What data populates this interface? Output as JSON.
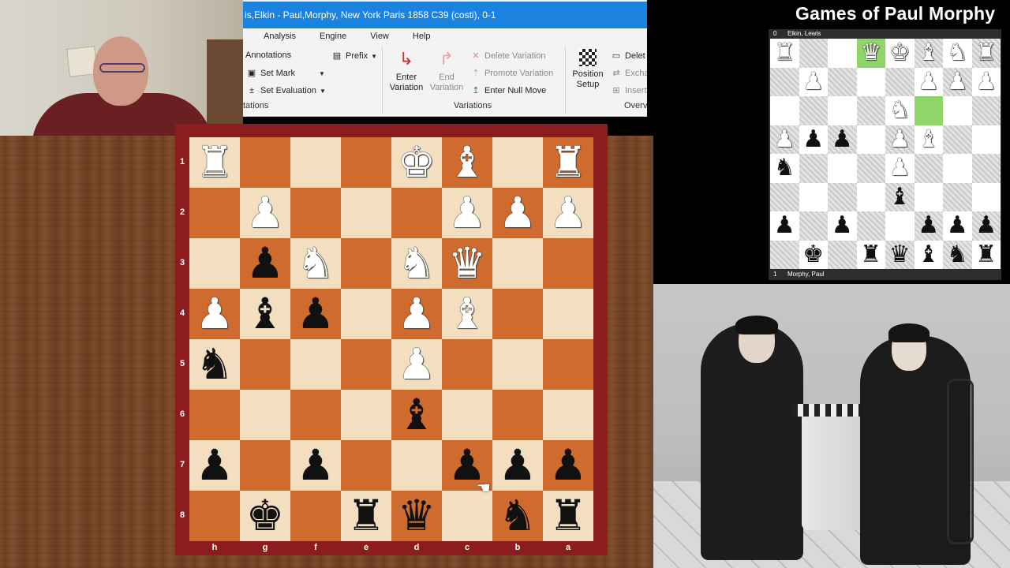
{
  "window": {
    "title": "is,Elkin - Paul,Morphy, New York Paris 1858  C39  (costi), 0-1"
  },
  "menu": [
    "Analysis",
    "Engine",
    "View",
    "Help"
  ],
  "ribbon": {
    "annotations": "Annotations",
    "prefix": "Prefix",
    "set_mark": "Set Mark",
    "set_evaluation": "Set Evaluation",
    "group_annotations": "tations",
    "enter_variation": [
      "Enter",
      "Variation"
    ],
    "end_variation": [
      "End",
      "Variation"
    ],
    "delete_variation": "Delete Variation",
    "promote_variation": "Promote Variation",
    "enter_null_move": "Enter Null Move",
    "group_variations": "Variations",
    "position_setup": [
      "Position",
      "Setup"
    ],
    "delete": "Delet",
    "exchange": "Excha",
    "insert": "Insert",
    "group_overview": "Overv"
  },
  "overlay_title": "Games of Paul Morphy",
  "board": {
    "ranks": [
      "1",
      "2",
      "3",
      "4",
      "5",
      "6",
      "7",
      "8"
    ],
    "files": [
      "h",
      "g",
      "f",
      "e",
      "d",
      "c",
      "b",
      "a"
    ],
    "rows": [
      [
        "wR",
        "",
        "",
        "",
        "wK",
        "wB",
        "",
        "wR"
      ],
      [
        "",
        "wP",
        "",
        "",
        "",
        "wP",
        "wP",
        "wP"
      ],
      [
        "",
        "bP",
        "wN",
        "",
        "wN",
        "wQ",
        "",
        ""
      ],
      [
        "wP",
        "bB",
        "bP",
        "",
        "wP",
        "wB",
        "",
        ""
      ],
      [
        "bN",
        "",
        "",
        "",
        "wP",
        "",
        "",
        ""
      ],
      [
        "",
        "",
        "",
        "",
        "bB",
        "",
        "",
        ""
      ],
      [
        "bP",
        "",
        "bP",
        "",
        "",
        "bP",
        "bP",
        "bP"
      ],
      [
        "",
        "bK",
        "",
        "bR",
        "bQ",
        "",
        "bN",
        "bR"
      ]
    ]
  },
  "mini_board": {
    "top_player_num": "0",
    "top_player": "Elkin, Lewis",
    "bottom_player_num": "1",
    "bottom_player": "Morphy, Paul",
    "rows": [
      [
        "wR",
        "",
        "",
        "wQ",
        "wK",
        "wB",
        "wN",
        "wR"
      ],
      [
        "",
        "wP",
        "",
        "",
        "",
        "wP",
        "wP",
        "wP"
      ],
      [
        "",
        "",
        "",
        "",
        "wN",
        "",
        "",
        ""
      ],
      [
        "wP",
        "bP",
        "bP",
        "",
        "wP",
        "wB",
        "",
        ""
      ],
      [
        "bN",
        "",
        "",
        "",
        "wP",
        "",
        "",
        ""
      ],
      [
        "",
        "",
        "",
        "",
        "bB",
        "",
        "",
        ""
      ],
      [
        "bP",
        "",
        "bP",
        "",
        "",
        "bP",
        "bP",
        "bP"
      ],
      [
        "",
        "bK",
        "",
        "bR",
        "bQ",
        "bB",
        "bN",
        "bR"
      ]
    ],
    "highlights": [
      [
        0,
        3
      ],
      [
        2,
        5
      ]
    ]
  },
  "glyphs": {
    "wK": "♚",
    "wQ": "♛",
    "wR": "♜",
    "wB": "♝",
    "wN": "♞",
    "wP": "♟",
    "bK": "♚",
    "bQ": "♛",
    "bR": "♜",
    "bB": "♝",
    "bN": "♞",
    "bP": "♟"
  },
  "colors": {
    "titlebar": "#1c82e0",
    "board_light": "#f3dfc0",
    "board_dark": "#cf6b2f",
    "board_frame": "#8c1c1e",
    "highlight": "#8fd56a"
  }
}
